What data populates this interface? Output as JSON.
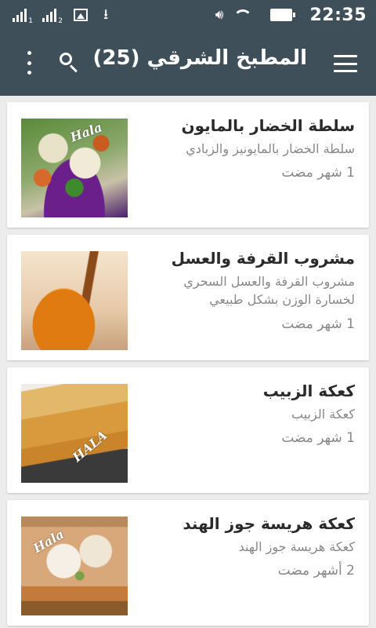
{
  "status_bar": {
    "sim1_label": "1",
    "sim2_label": "2",
    "time": "22:35"
  },
  "toolbar": {
    "title": "المطبخ الشرقي (25)",
    "icons": [
      "more-vert-icon",
      "search-icon",
      "menu-icon"
    ]
  },
  "recipes": [
    {
      "title": "سلطة الخضار بالمايون",
      "description": "سلطة الخضار بالمايونيز والزبادي",
      "time": "1 شهر مضت",
      "watermark": "Hala"
    },
    {
      "title": "مشروب القرفة والعسل",
      "description": "مشروب القرفة والعسل السحري لخسارة الوزن بشكل طبيعي",
      "time": "1 شهر مضت",
      "watermark": ""
    },
    {
      "title": "كعكة الزبيب",
      "description": "كعكة الزبيب",
      "time": "1 شهر مضت",
      "watermark": "HALA"
    },
    {
      "title": "كعكة هريسة جوز الهند",
      "description": "كعكة هريسة جوز الهند",
      "time": "2 أشهر مضت",
      "watermark": "Hala"
    }
  ],
  "colors": {
    "toolbar": "#3f4f59",
    "background": "#ececec",
    "card": "#ffffff",
    "title_text": "#2a2a2a",
    "secondary_text": "#888888"
  }
}
